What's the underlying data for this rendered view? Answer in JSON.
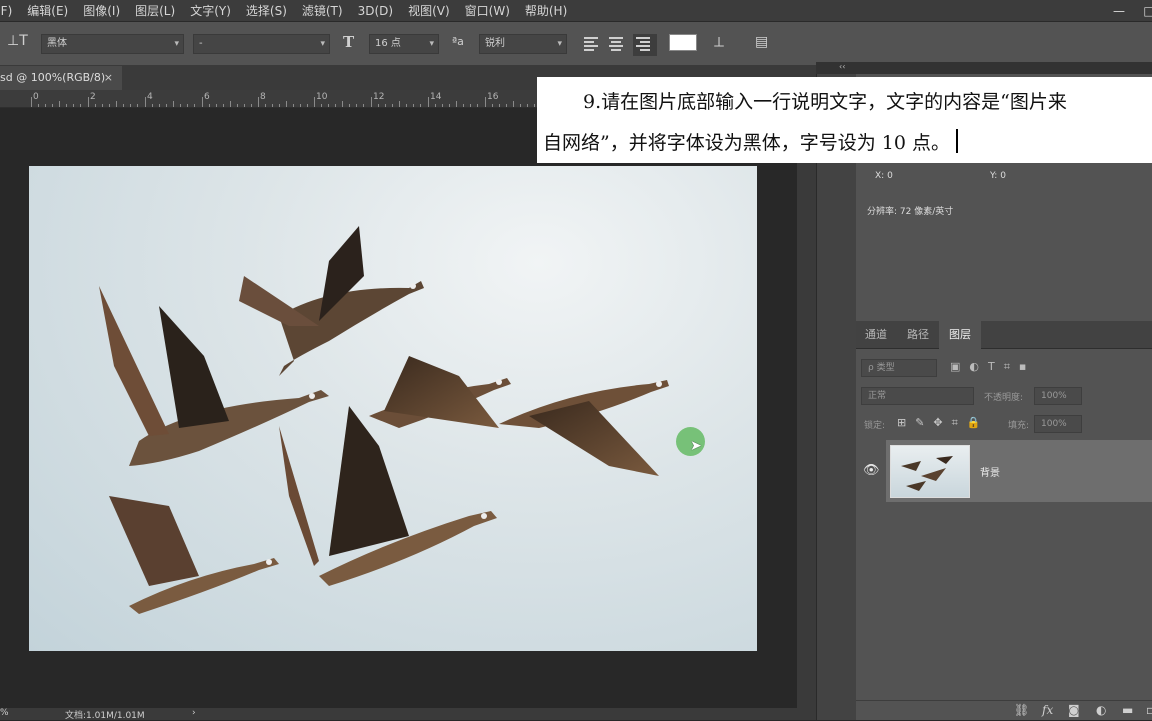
{
  "menu": [
    "(F)",
    "编辑(E)",
    "图像(I)",
    "图层(L)",
    "文字(Y)",
    "选择(S)",
    "滤镜(T)",
    "3D(D)",
    "视图(V)",
    "窗口(W)",
    "帮助(H)"
  ],
  "window_controls": {
    "minimize": "—",
    "maximize": "□"
  },
  "options": {
    "font_family": "黑体",
    "font_style": "-",
    "font_size": "16 点",
    "antialias_icon_text": "ªa",
    "antialias": "锐利"
  },
  "document_tab": {
    "title": "sd @ 100%(RGB/8)",
    "close": "×"
  },
  "ruler_labels": [
    "0",
    "2",
    "4",
    "6",
    "8",
    "10",
    "12",
    "14",
    "16"
  ],
  "status": {
    "zoom": "%",
    "doc_info": "文档:1.01M/1.01M",
    "arrow": "›"
  },
  "panel_collapse": "‹‹",
  "info": {
    "x_label": "X:",
    "x": "0",
    "y_label": "Y:",
    "y": "0",
    "resolution": "分辨率: 72 像素/英寸"
  },
  "layers_panel": {
    "tabs": [
      "通道",
      "路径",
      "图层"
    ],
    "active_tab": "图层",
    "filter": "ρ 类型",
    "blend_mode": "正常",
    "opacity_label": "不透明度:",
    "opacity": "100%",
    "lock_label": "锁定:",
    "fill_label": "填充:",
    "fill": "100%",
    "layer_name": "背景"
  },
  "instruction": {
    "line1": "9.请在图片底部输入一行说明文字，文字的内容是“图片来",
    "line2": "自网络”，并将字体设为黑体，字号设为 10 点。"
  },
  "colors": {
    "canvas_bg": "#282828",
    "panel_bg": "#535353",
    "cursor_dot": "#6cbd6c"
  }
}
